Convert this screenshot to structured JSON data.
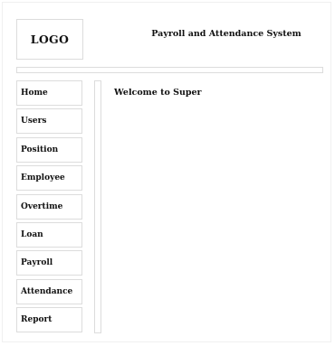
{
  "header": {
    "logo_text": "LOGO",
    "title": "Payroll and Attendance System"
  },
  "sidebar": {
    "items": [
      {
        "label": "Home"
      },
      {
        "label": "Users"
      },
      {
        "label": "Position"
      },
      {
        "label": "Employee"
      },
      {
        "label": "Overtime"
      },
      {
        "label": "Loan"
      },
      {
        "label": "Payroll"
      },
      {
        "label": "Attendance"
      },
      {
        "label": "Report"
      }
    ]
  },
  "main": {
    "welcome_text": "Welcome to Super"
  }
}
